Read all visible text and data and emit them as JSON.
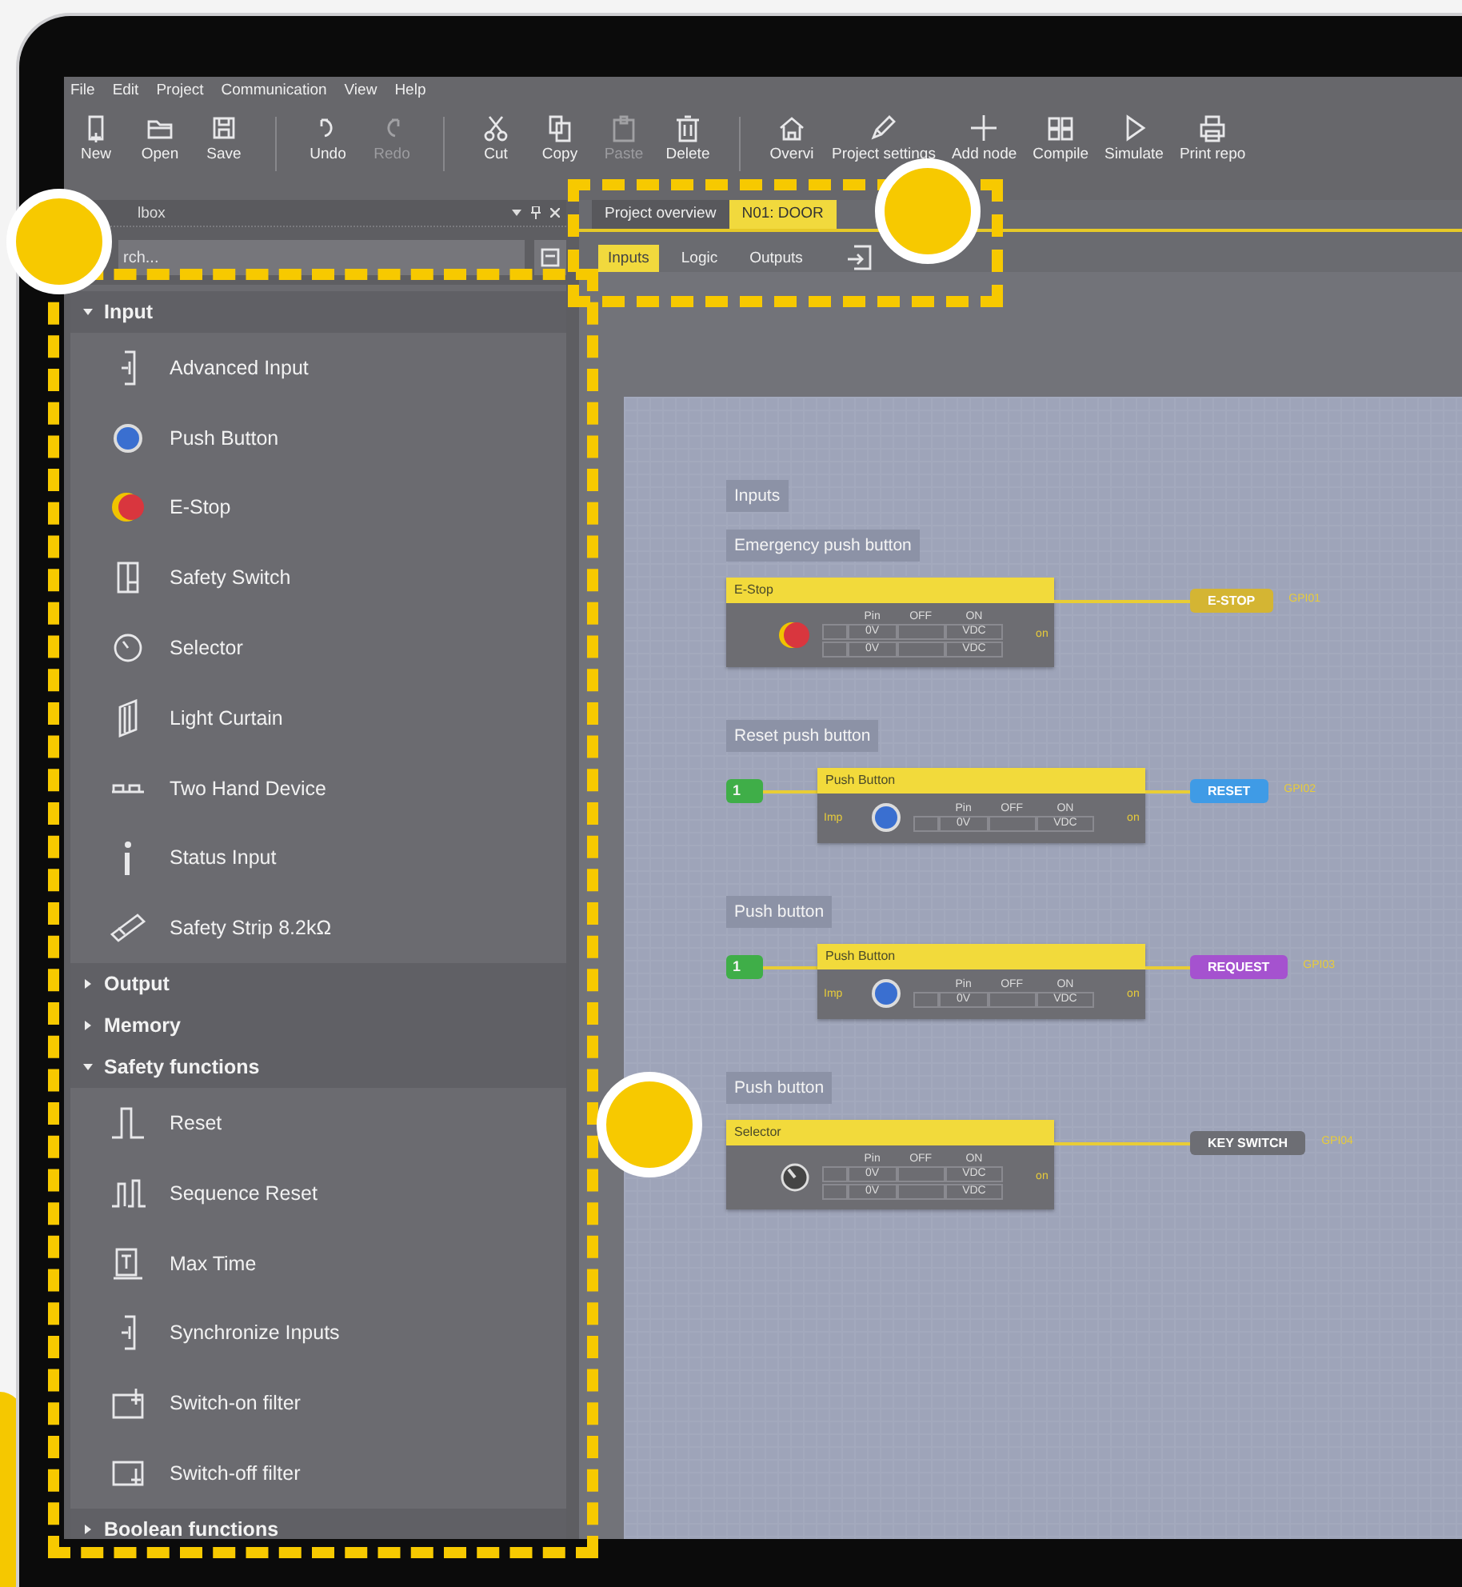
{
  "menu": [
    "File",
    "Edit",
    "Project",
    "Communication",
    "View",
    "Help"
  ],
  "toolbar_groups": [
    {
      "buttons": [
        {
          "label": "New",
          "disabled": false
        },
        {
          "label": "Open",
          "disabled": false
        },
        {
          "label": "Save",
          "disabled": false
        }
      ]
    },
    {
      "buttons": [
        {
          "label": "Undo",
          "disabled": false
        },
        {
          "label": "Redo",
          "disabled": true
        }
      ]
    },
    {
      "buttons": [
        {
          "label": "Cut",
          "disabled": false
        },
        {
          "label": "Copy",
          "disabled": false
        },
        {
          "label": "Paste",
          "disabled": true
        },
        {
          "label": "Delete",
          "disabled": false
        }
      ]
    },
    {
      "buttons": [
        {
          "label": "Overvi",
          "disabled": false
        },
        {
          "label": "Project settings",
          "disabled": false
        },
        {
          "label": "Add node",
          "disabled": false
        },
        {
          "label": "Compile",
          "disabled": false
        },
        {
          "label": "Simulate",
          "disabled": false
        },
        {
          "label": "Print repo",
          "disabled": false
        }
      ]
    }
  ],
  "toolbox": {
    "title": "lbox",
    "search": {
      "placeholder": "rch..."
    },
    "categories": [
      {
        "label": "Input",
        "expanded": true,
        "items": [
          "Advanced Input",
          "Push Button",
          "E-Stop",
          "Safety Switch",
          "Selector",
          "Light Curtain",
          "Two Hand Device",
          "Status Input",
          "Safety Strip 8.2kΩ"
        ]
      },
      {
        "label": "Output",
        "expanded": false
      },
      {
        "label": "Memory",
        "expanded": false
      },
      {
        "label": "Safety functions",
        "expanded": true,
        "items": [
          "Reset",
          "Sequence Reset",
          "Max Time",
          "Synchronize Inputs",
          "Switch-on filter",
          "Switch-off filter"
        ]
      },
      {
        "label": "Boolean functions",
        "expanded": false
      }
    ]
  },
  "tabs": [
    {
      "label": "Project overview",
      "selected": false
    },
    {
      "label": "N01: DOOR",
      "selected": true
    }
  ],
  "subtabs": [
    {
      "label": "Inputs",
      "selected": true
    },
    {
      "label": "Logic",
      "selected": false
    },
    {
      "label": "Outputs",
      "selected": false
    }
  ],
  "canvas": {
    "group_label": "Inputs",
    "sections": [
      {
        "caption": "Emergency push button",
        "node": {
          "title": "E-Stop",
          "kind": "estop",
          "output_port": "on",
          "headers": [
            "Pin",
            "OFF",
            "ON"
          ],
          "rows": [
            {
              "off": "0V",
              "on": "VDC"
            },
            {
              "off": "0V",
              "on": "VDC"
            }
          ]
        },
        "output": {
          "label": "E-STOP",
          "color": "#d4b533",
          "gpio": "GPI01"
        }
      },
      {
        "caption": "Reset push button",
        "constant": "1",
        "node": {
          "title": "Push Button",
          "kind": "push",
          "input_port": "Imp",
          "output_port": "on",
          "headers": [
            "Pin",
            "OFF",
            "ON"
          ],
          "rows": [
            {
              "off": "0V",
              "on": "VDC"
            }
          ]
        },
        "output": {
          "label": "RESET",
          "color": "#3f9be6",
          "gpio": "GPI02"
        }
      },
      {
        "caption": "Push button",
        "constant": "1",
        "node": {
          "title": "Push Button",
          "kind": "push",
          "input_port": "Imp",
          "output_port": "on",
          "headers": [
            "Pin",
            "OFF",
            "ON"
          ],
          "rows": [
            {
              "off": "0V",
              "on": "VDC"
            }
          ]
        },
        "output": {
          "label": "REQUEST",
          "color": "#a552cf",
          "gpio": "GPI03"
        }
      },
      {
        "caption": "Push button",
        "node": {
          "title": "Selector",
          "kind": "selector",
          "output_port": "on",
          "headers": [
            "Pin",
            "OFF",
            "ON"
          ],
          "rows": [
            {
              "off": "0V",
              "on": "VDC"
            },
            {
              "off": "0V",
              "on": "VDC"
            }
          ]
        },
        "output": {
          "label": "KEY SWITCH",
          "color": "#6d6e74",
          "gpio": "GPI04"
        }
      }
    ]
  }
}
